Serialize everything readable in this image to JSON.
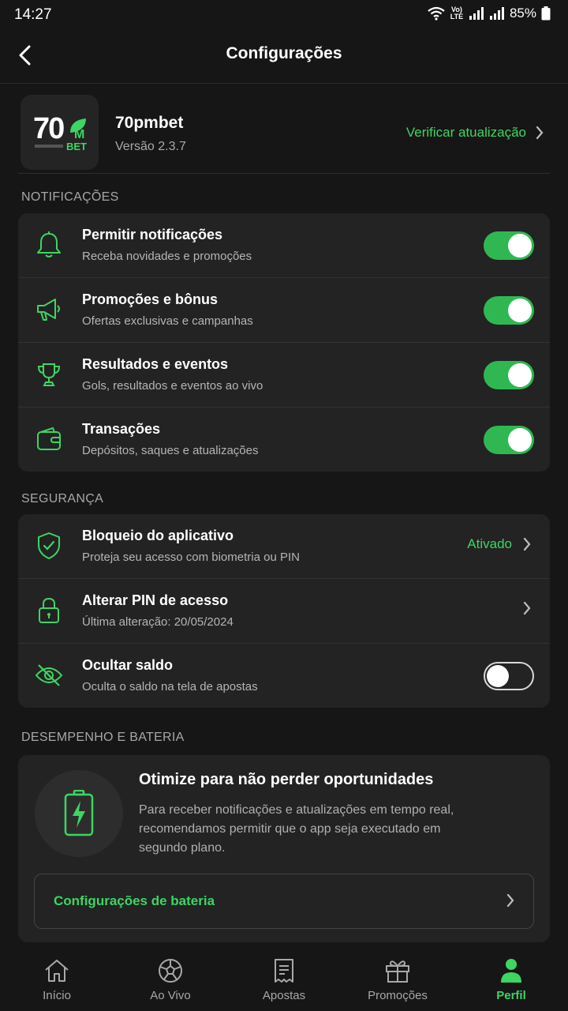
{
  "status_bar": {
    "time": "14:27",
    "battery": "85%",
    "network": "Vo) LTE"
  },
  "header": {
    "title": "Configurações"
  },
  "app": {
    "logo_text": "70",
    "logo_suffix": "M",
    "logo_sub": "BET",
    "name": "70pmbet",
    "version": "Versão 2.3.7",
    "check_update": "Verificar atualização"
  },
  "notifications": {
    "section_title": "NOTIFICAÇÕES",
    "items": [
      {
        "title": "Permitir notificações",
        "subtitle": "Receba novidades e promoções",
        "icon": "bell-icon",
        "enabled": true
      },
      {
        "title": "Promoções e bônus",
        "subtitle": "Ofertas exclusivas e campanhas",
        "icon": "megaphone-icon",
        "enabled": true
      },
      {
        "title": "Resultados e eventos",
        "subtitle": "Gols, resultados e eventos ao vivo",
        "icon": "trophy-icon",
        "enabled": true
      },
      {
        "title": "Transações",
        "subtitle": "Depósitos, saques e atualizações",
        "icon": "wallet-icon",
        "enabled": true
      }
    ]
  },
  "security": {
    "section_title": "SEGURANÇA",
    "items": [
      {
        "title": "Bloqueio do aplicativo",
        "subtitle": "Proteja seu acesso com biometria ou PIN",
        "icon": "shield-check-icon",
        "value": "Ativado"
      },
      {
        "title": "Alterar PIN de acesso",
        "subtitle": "Última alteração: 20/05/2024",
        "icon": "lock-icon"
      },
      {
        "title": "Ocultar saldo",
        "subtitle": "Oculta o saldo na tela de apostas",
        "icon": "eye-off-icon",
        "enabled": false
      }
    ]
  },
  "performance": {
    "section_title": "DESEMPENHO E BATERIA",
    "title": "Otimize para não perder oportunidades",
    "description": "Para receber notificações e atualizações em tempo real, recomendamos permitir que o app seja executado em segundo plano.",
    "button_label": "Configurações de bateria"
  },
  "bottom_nav": [
    {
      "label": "Início",
      "icon": "home-icon",
      "active": false
    },
    {
      "label": "Ao Vivo",
      "icon": "soccer-ball-icon",
      "active": false
    },
    {
      "label": "Apostas",
      "icon": "ticket-icon",
      "active": false
    },
    {
      "label": "Promoções",
      "icon": "gift-icon",
      "active": false
    },
    {
      "label": "Perfil",
      "icon": "profile-icon",
      "active": true
    }
  ],
  "colors": {
    "accent": "#3dd563",
    "toggle_on": "#2fb852",
    "card": "#232323",
    "background": "#161616"
  }
}
